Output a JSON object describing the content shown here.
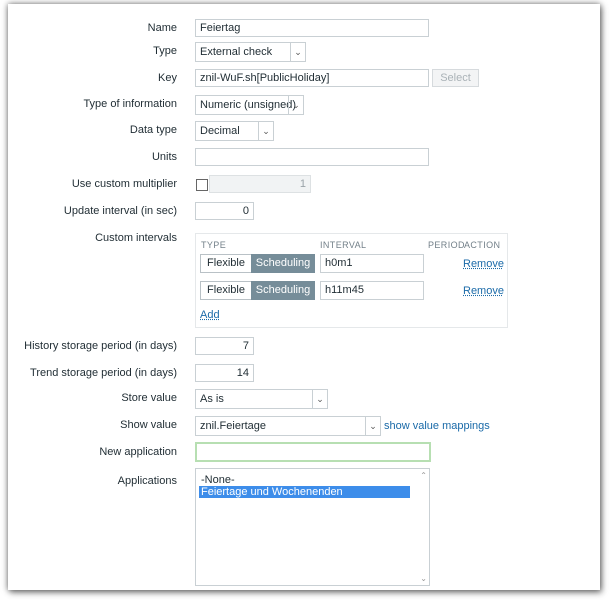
{
  "form": {
    "name": {
      "label": "Name",
      "value": "Feiertag"
    },
    "type": {
      "label": "Type",
      "value": "External check"
    },
    "key": {
      "label": "Key",
      "value": "znil-WuF.sh[PublicHoliday]",
      "button": "Select"
    },
    "type_of_information": {
      "label": "Type of information",
      "value": "Numeric (unsigned)"
    },
    "data_type": {
      "label": "Data type",
      "value": "Decimal"
    },
    "units": {
      "label": "Units",
      "value": ""
    },
    "custom_multiplier": {
      "label": "Use custom multiplier",
      "value": "1",
      "checked": false
    },
    "update_interval": {
      "label": "Update interval (in sec)",
      "value": "0"
    },
    "custom_intervals": {
      "label": "Custom intervals",
      "headers": {
        "type": "TYPE",
        "interval": "INTERVAL",
        "period": "PERIOD",
        "action": "ACTION"
      },
      "rows": [
        {
          "flexible": "Flexible",
          "scheduling": "Scheduling",
          "interval": "h0m1",
          "action": "Remove"
        },
        {
          "flexible": "Flexible",
          "scheduling": "Scheduling",
          "interval": "h11m45",
          "action": "Remove"
        }
      ],
      "add": "Add"
    },
    "history": {
      "label": "History storage period (in days)",
      "value": "7"
    },
    "trend": {
      "label": "Trend storage period (in days)",
      "value": "14"
    },
    "store_value": {
      "label": "Store value",
      "value": "As is"
    },
    "show_value": {
      "label": "Show value",
      "value": "znil.Feiertage",
      "link": "show value mappings"
    },
    "new_application": {
      "label": "New application",
      "value": ""
    },
    "applications": {
      "label": "Applications",
      "options": [
        "-None-",
        "Feiertage und Wochenenden"
      ],
      "selected": "Feiertage und Wochenenden"
    }
  }
}
